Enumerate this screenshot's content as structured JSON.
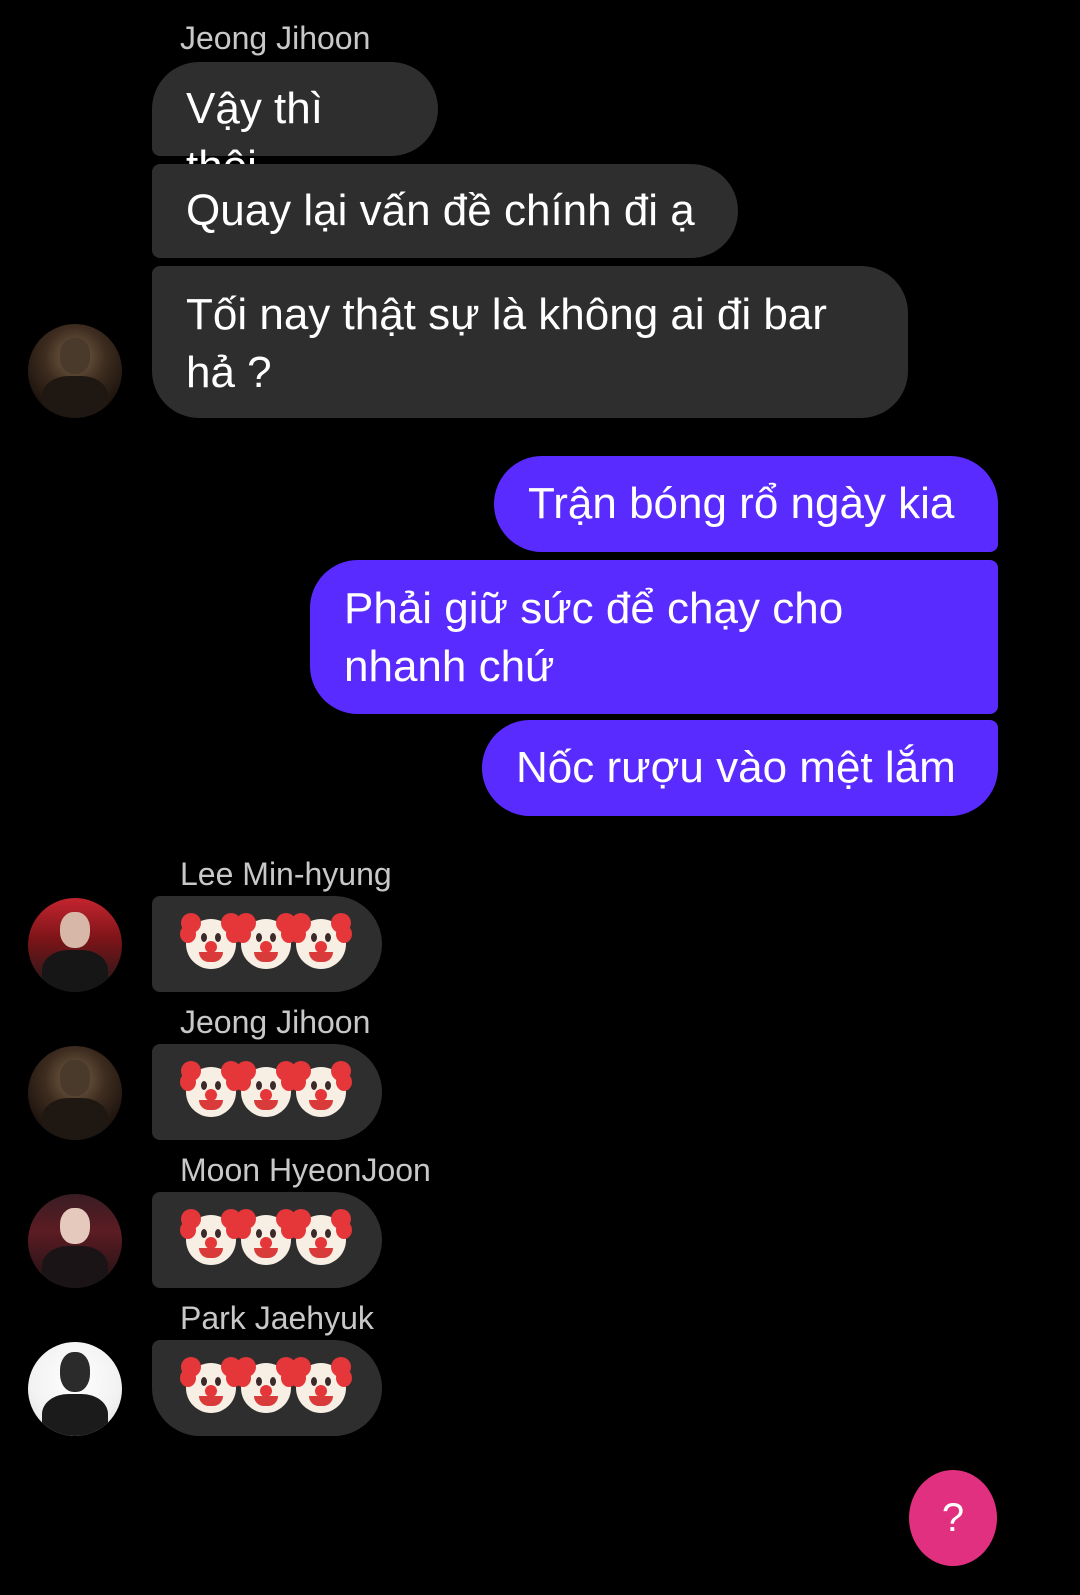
{
  "messages": [
    {
      "sender": "Jeong Jihoon",
      "lines": [
        "Vậy thì thôi",
        "Quay lại vấn đề chính đi ạ",
        "Tối nay thật sự là không ai đi bar hả ?"
      ]
    },
    {
      "outgoing": [
        "Trận bóng rổ ngày kia",
        "Phải giữ sức để chạy cho nhanh chứ",
        "Nốc rượu vào mệt lắm"
      ]
    },
    {
      "sender": "Lee Min-hyung",
      "emoji": "clown x3"
    },
    {
      "sender": "Jeong Jihoon",
      "emoji": "clown x3"
    },
    {
      "sender": "Moon HyeonJoon",
      "emoji": "clown x3"
    },
    {
      "sender": "Park Jaehyuk",
      "emoji": "clown x3"
    }
  ],
  "chat": {
    "group1_sender": "Jeong Jihoon",
    "in1": "Vậy thì thôi",
    "in2": "Quay lại vấn đề chính đi ạ",
    "in3": "Tối nay thật sự là không ai đi bar hả ?",
    "out1": "Trận bóng rổ ngày kia",
    "out2": "Phải giữ sức để chạy cho nhanh chứ",
    "out3": "Nốc rượu vào mệt lắm",
    "sender2": "Lee Min-hyung",
    "sender3": "Jeong Jihoon",
    "sender4": "Moon HyeonJoon",
    "sender5": "Park Jaehyuk"
  },
  "emoji_icon": "clown-face-emoji",
  "help_button": {
    "label": "?",
    "color": "#e0307f"
  },
  "colors": {
    "background": "#000000",
    "incoming_bubble": "#2e2e2e",
    "outgoing_bubble": "#5a2bff",
    "sender_name": "#c8c8c8"
  }
}
